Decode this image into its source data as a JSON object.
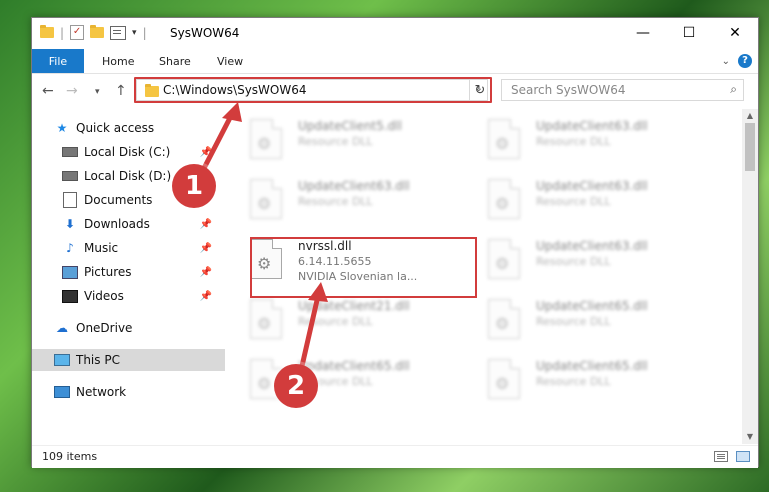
{
  "window": {
    "title": "SysWOW64",
    "controls": [
      "—",
      "☐",
      "✕"
    ]
  },
  "ribbon": {
    "tabs": [
      "File",
      "Home",
      "Share",
      "View"
    ]
  },
  "address_bar": {
    "path": "C:\\Windows\\SysWOW64",
    "search_placeholder": "Search SysWOW64"
  },
  "nav_pane": {
    "items": [
      {
        "label": "Quick access",
        "icon": "star-icon"
      },
      {
        "label": "Local Disk (C:)",
        "icon": "drive-icon",
        "pinned": true
      },
      {
        "label": "Local Disk (D:)",
        "icon": "drive-icon",
        "pinned": true
      },
      {
        "label": "Documents",
        "icon": "documents-icon",
        "pinned": true
      },
      {
        "label": "Downloads",
        "icon": "downloads-icon",
        "pinned": true
      },
      {
        "label": "Music",
        "icon": "music-icon",
        "pinned": true
      },
      {
        "label": "Pictures",
        "icon": "pictures-icon",
        "pinned": true
      },
      {
        "label": "Videos",
        "icon": "videos-icon",
        "pinned": true
      },
      {
        "label": "OneDrive",
        "icon": "cloud-icon"
      },
      {
        "label": "This PC",
        "icon": "computer-icon",
        "selected": true
      },
      {
        "label": "Network",
        "icon": "network-icon"
      }
    ]
  },
  "files": {
    "left": [
      {
        "name": "UpdateClient5.dll",
        "desc": "Resource DLL"
      },
      {
        "name": "UpdateClient63.dll",
        "desc": "Resource DLL"
      },
      {
        "name": "nvrssl.dll",
        "version": "6.14.11.5655",
        "desc": "NVIDIA Slovenian la..."
      },
      {
        "name": "UpdateClient21.dll",
        "desc": "Resource DLL"
      },
      {
        "name": "UpdateClient65.dll",
        "desc": "Resource DLL"
      }
    ],
    "right": [
      {
        "name": "UpdateClient63.dll",
        "desc": "Resource DLL"
      },
      {
        "name": "UpdateClient63.dll",
        "desc": "Resource DLL"
      },
      {
        "name": "UpdateClient63.dll",
        "desc": "Resource DLL"
      },
      {
        "name": "UpdateClient65.dll",
        "desc": "Resource DLL"
      },
      {
        "name": "UpdateClient65.dll",
        "desc": "Resource DLL"
      }
    ]
  },
  "status": {
    "item_count": "109 items"
  },
  "callouts": {
    "step1": "1",
    "step2": "2"
  },
  "colors": {
    "accent": "#1979ca",
    "callout": "#d23c3c"
  }
}
